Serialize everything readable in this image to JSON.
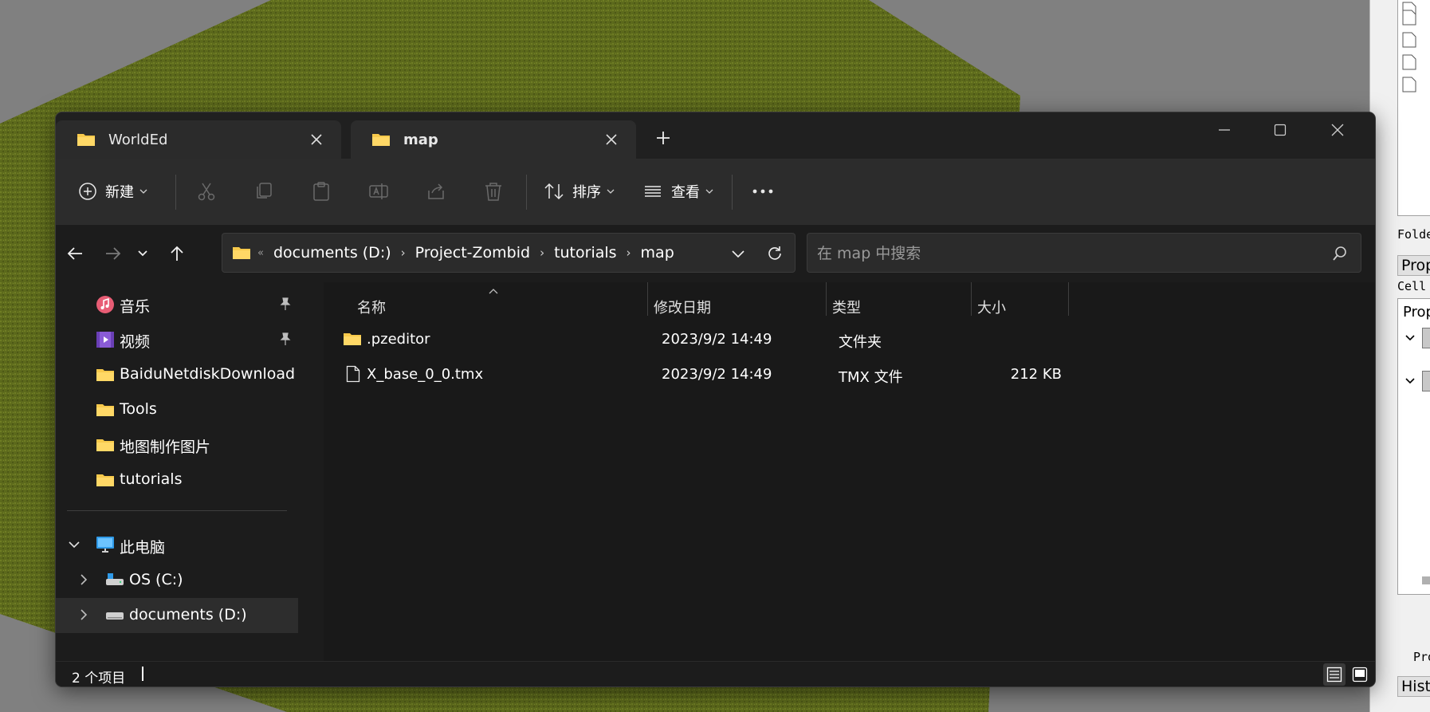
{
  "explorer": {
    "tabs": [
      {
        "label": "WorldEd"
      },
      {
        "label": "map"
      }
    ],
    "toolbar": {
      "new_label": "新建",
      "sort_label": "排序",
      "view_label": "查看"
    },
    "address": {
      "crumbs": [
        "documents (D:)",
        "Project-Zombid",
        "tutorials",
        "map"
      ]
    },
    "search": {
      "placeholder": "在 map 中搜索"
    },
    "nav": {
      "items": [
        {
          "label": "音乐",
          "icon": "music-icon"
        },
        {
          "label": "视频",
          "icon": "video-icon"
        },
        {
          "label": "BaiduNetdiskDownload",
          "icon": "folder-icon"
        },
        {
          "label": "Tools",
          "icon": "folder-icon"
        },
        {
          "label": "地图制作图片",
          "icon": "folder-icon"
        },
        {
          "label": "tutorials",
          "icon": "folder-icon"
        },
        {
          "label": "此电脑",
          "icon": "computer-icon"
        },
        {
          "label": "OS (C:)",
          "icon": "drive-icon"
        },
        {
          "label": "documents (D:)",
          "icon": "drive-icon"
        }
      ]
    },
    "columns": {
      "name": "名称",
      "modified": "修改日期",
      "type": "类型",
      "size": "大小"
    },
    "files": [
      {
        "name": ".pzeditor",
        "modified": "2023/9/2 14:49",
        "type": "文件夹",
        "size": "",
        "icon": "folder-icon"
      },
      {
        "name": "X_base_0_0.tmx",
        "modified": "2023/9/2 14:49",
        "type": "TMX 文件",
        "size": "212 KB",
        "icon": "file-icon"
      }
    ],
    "status": {
      "count": "2 个项目"
    }
  },
  "side_panel": {
    "folder_label": "Folde",
    "prop_header": "Prop",
    "cell_label": "Cell",
    "prop_label": "Prop",
    "pro_label": "Pro",
    "history_header": "Histo"
  }
}
